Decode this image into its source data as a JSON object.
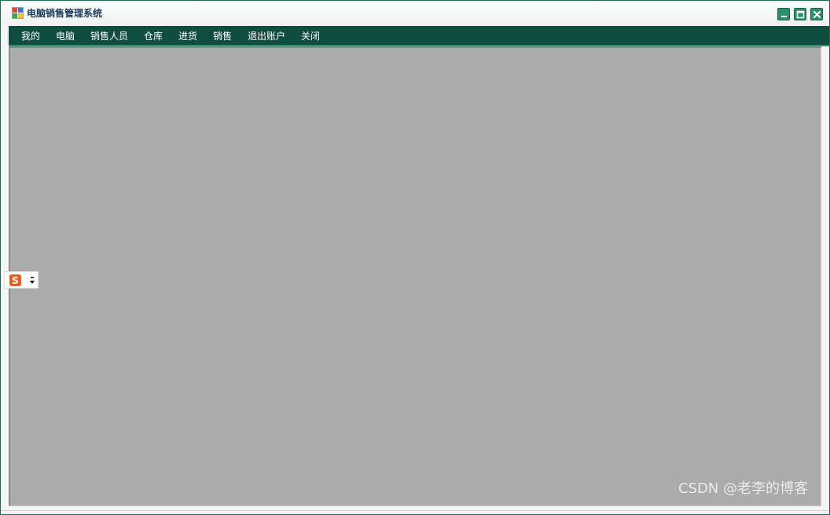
{
  "window": {
    "title": "电脑销售管理系统"
  },
  "menu": {
    "items": [
      {
        "label": "我的"
      },
      {
        "label": "电脑"
      },
      {
        "label": "销售人员"
      },
      {
        "label": "仓库"
      },
      {
        "label": "进货"
      },
      {
        "label": "销售"
      },
      {
        "label": "退出账户"
      },
      {
        "label": "关闭"
      }
    ]
  },
  "ime": {
    "logo_letter": "S"
  },
  "watermark": {
    "text": "CSDN @老李的博客"
  },
  "colors": {
    "menu_bg": "#0e4d40",
    "client_bg": "#ababab",
    "window_button": "#2f8f6c",
    "ime_accent": "#f05a1e"
  }
}
